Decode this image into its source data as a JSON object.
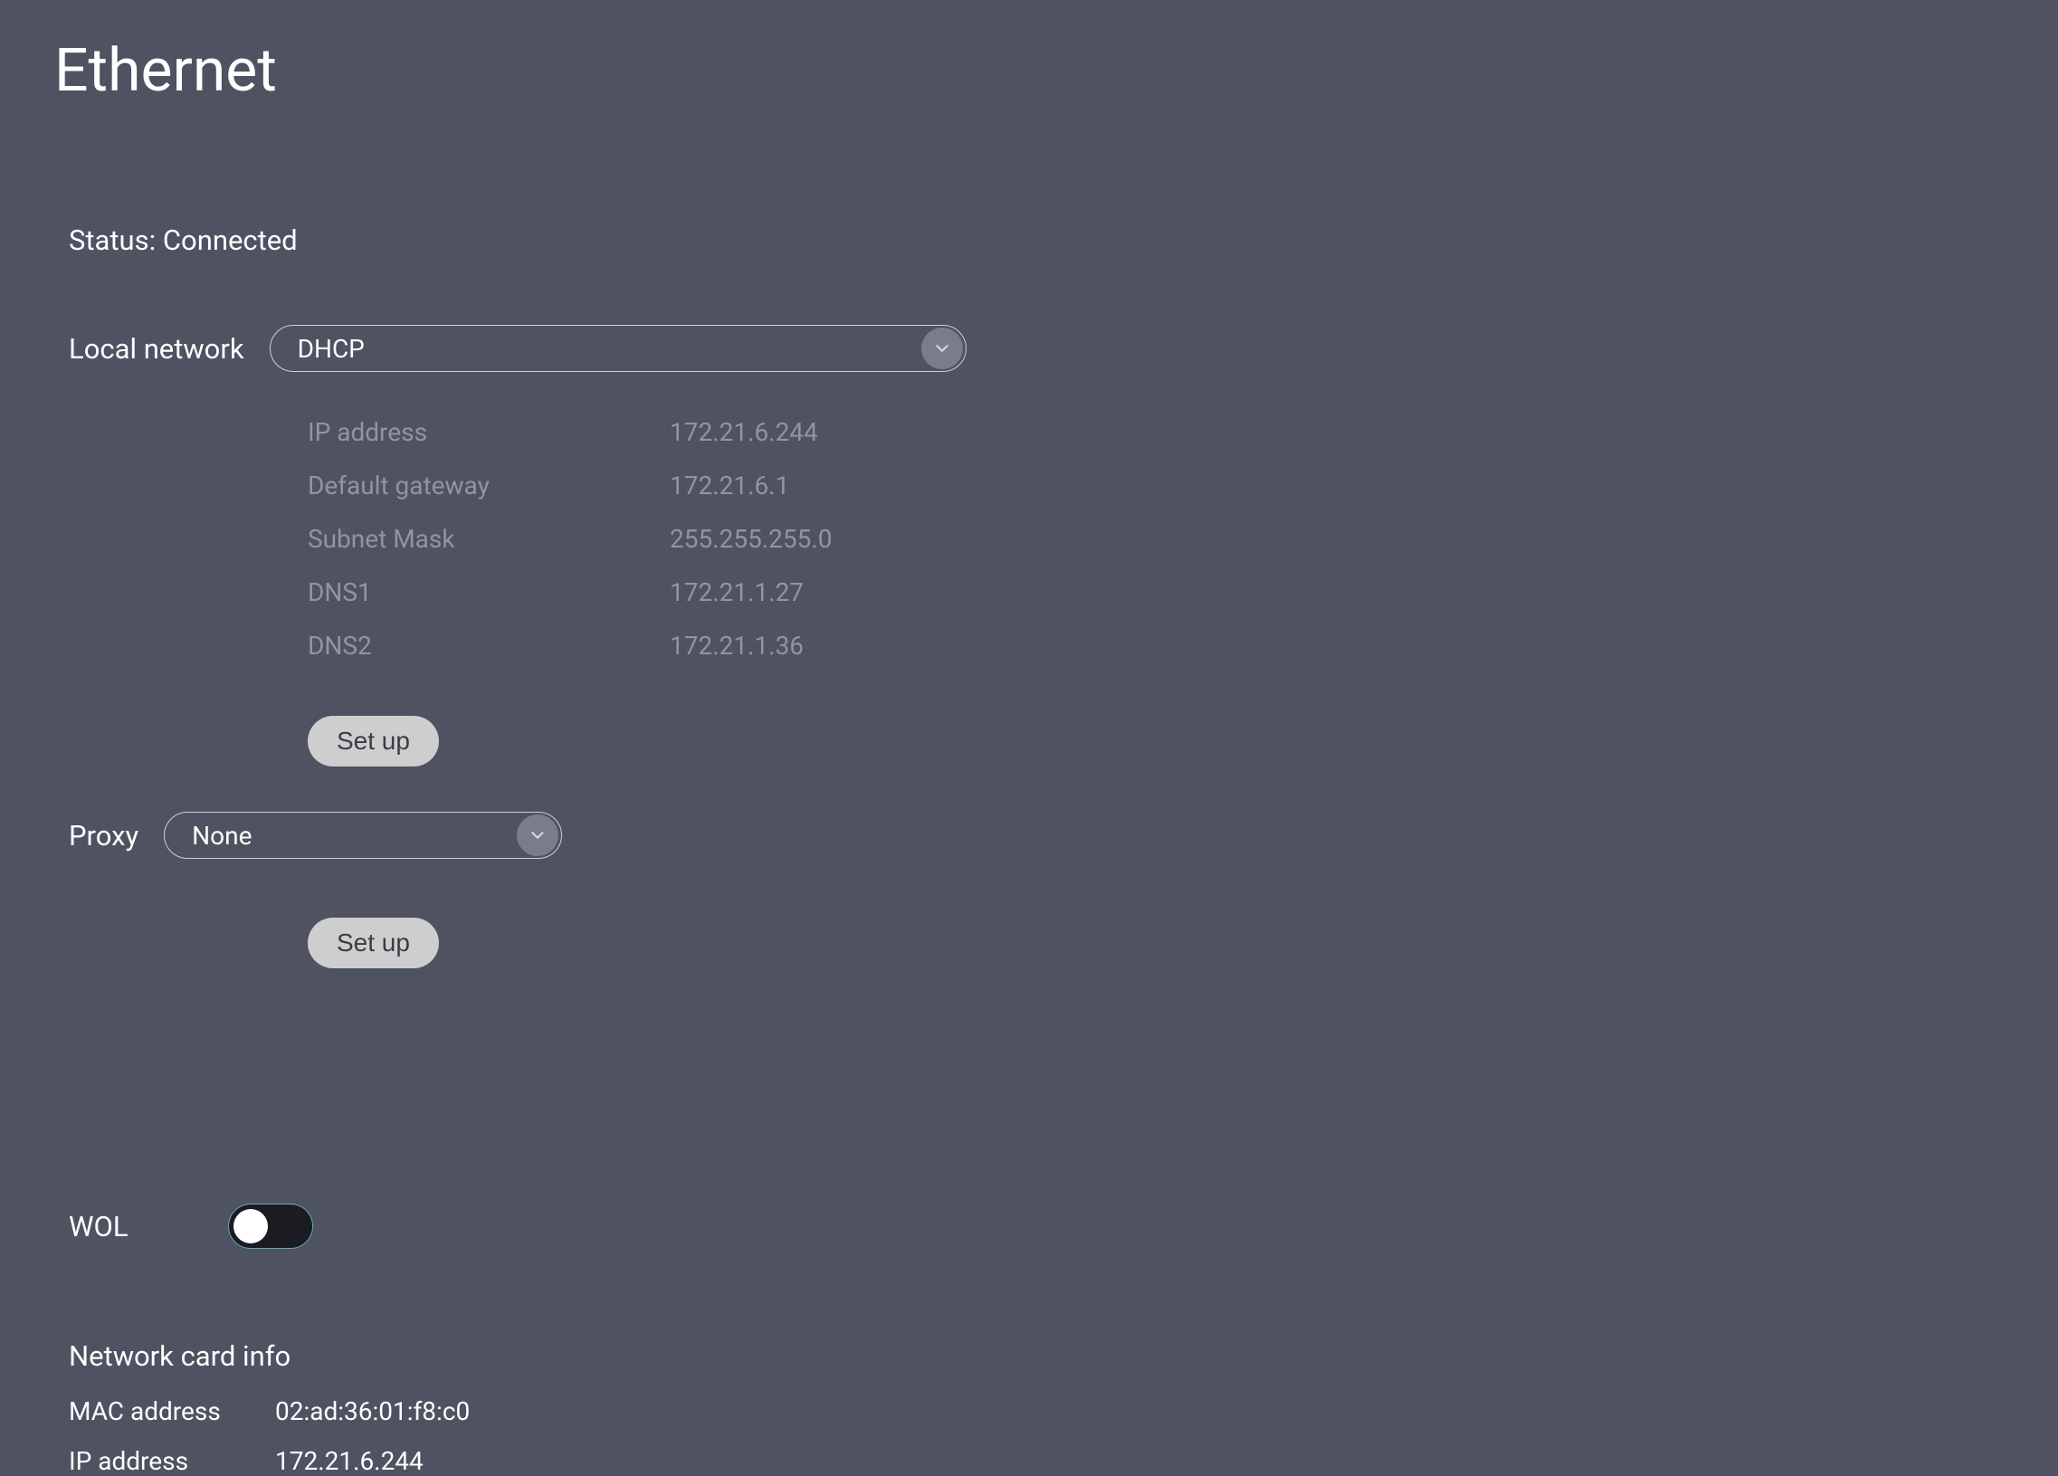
{
  "page_title": "Ethernet",
  "status": {
    "label": "Status",
    "value": "Connected"
  },
  "local_network": {
    "label": "Local network",
    "mode": "DHCP",
    "details": {
      "ip_address_label": "IP address",
      "ip_address_value": "172.21.6.244",
      "default_gateway_label": "Default gateway",
      "default_gateway_value": "172.21.6.1",
      "subnet_mask_label": "Subnet Mask",
      "subnet_mask_value": "255.255.255.0",
      "dns1_label": "DNS1",
      "dns1_value": "172.21.1.27",
      "dns2_label": "DNS2",
      "dns2_value": "172.21.1.36"
    },
    "setup_label": "Set up"
  },
  "proxy": {
    "label": "Proxy",
    "mode": "None",
    "setup_label": "Set up"
  },
  "wol": {
    "label": "WOL",
    "enabled": false
  },
  "network_card": {
    "title": "Network card info",
    "mac_label": "MAC address",
    "mac_value": "02:ad:36:01:f8:c0",
    "ip_label": "IP address",
    "ip_value": "172.21.6.244"
  }
}
